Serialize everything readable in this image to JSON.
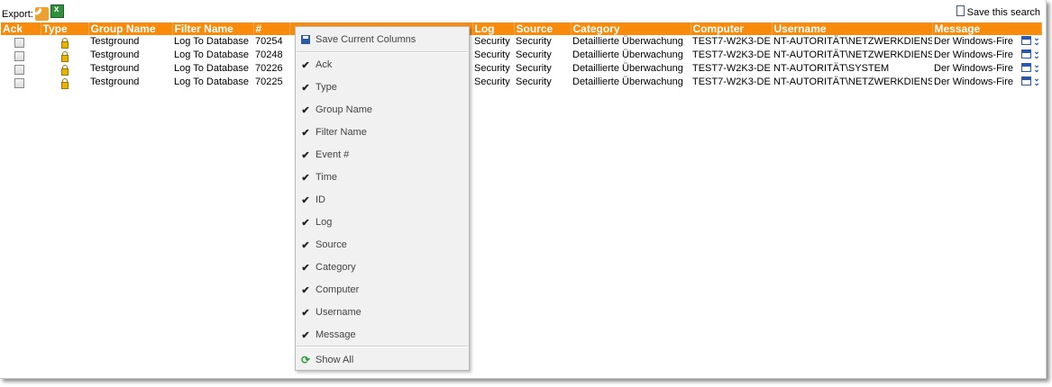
{
  "toolbar": {
    "export_label": "Export:",
    "rss_icon": "rss-feed-icon",
    "excel_icon": "excel-export-icon",
    "save_search_label": "Save this search"
  },
  "colors": {
    "header_bg": "#f88a0c",
    "header_text": "#ffffff",
    "icon_blue": "#2a58b0"
  },
  "table": {
    "columns": [
      "Ack",
      "Type",
      "Group Name",
      "Filter Name",
      "#",
      "",
      "Log",
      "Source",
      "Category",
      "Computer",
      "Username",
      "Message"
    ],
    "rows": [
      {
        "group": "Testground",
        "filter": "Log To Database",
        "num": "70254",
        "log": "Security",
        "source": "Security",
        "category": "Detaillierte Überwachung",
        "computer": "TEST7-W2K3-DE",
        "username": "NT-AUTORITÄT\\NETZWERKDIENST",
        "message": "Der Windows-Fire"
      },
      {
        "group": "Testground",
        "filter": "Log To Database",
        "num": "70248",
        "log": "Security",
        "source": "Security",
        "category": "Detaillierte Überwachung",
        "computer": "TEST7-W2K3-DE",
        "username": "NT-AUTORITÄT\\NETZWERKDIENST",
        "message": "Der Windows-Fire"
      },
      {
        "group": "Testground",
        "filter": "Log To Database",
        "num": "70226",
        "log": "Security",
        "source": "Security",
        "category": "Detaillierte Überwachung",
        "computer": "TEST7-W2K3-DE",
        "username": "NT-AUTORITÄT\\SYSTEM",
        "message": "Der Windows-Fire"
      },
      {
        "group": "Testground",
        "filter": "Log To Database",
        "num": "70225",
        "log": "Security",
        "source": "Security",
        "category": "Detaillierte Überwachung",
        "computer": "TEST7-W2K3-DE",
        "username": "NT-AUTORITÄT\\NETZWERKDIENST",
        "message": "Der Windows-Fire"
      }
    ]
  },
  "menu": {
    "save_columns": "Save Current Columns",
    "items": [
      "Ack",
      "Type",
      "Group Name",
      "Filter Name",
      "Event #",
      "Time",
      "ID",
      "Log",
      "Source",
      "Category",
      "Computer",
      "Username",
      "Message"
    ],
    "show_all": "Show All"
  }
}
